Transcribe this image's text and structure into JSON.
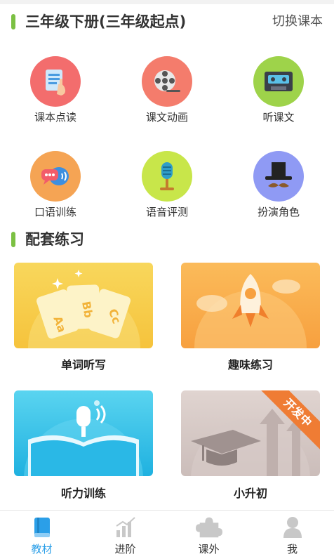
{
  "header": {
    "title": "三年级下册(三年级起点)",
    "switch_label": "切换课本",
    "accent": "#7bc043"
  },
  "features": [
    {
      "label": "课本点读",
      "icon": "book-reading-icon",
      "color": "#f36d6d"
    },
    {
      "label": "课文动画",
      "icon": "film-reel-icon",
      "color": "#f47c6c"
    },
    {
      "label": "听课文",
      "icon": "cassette-icon",
      "color": "#9ed34a"
    },
    {
      "label": "口语训练",
      "icon": "speech-bubbles-icon",
      "color": "#f5a454"
    },
    {
      "label": "语音评测",
      "icon": "microphone-icon",
      "color": "#c8e64a"
    },
    {
      "label": "扮演角色",
      "icon": "hat-mustache-icon",
      "color": "#8f9af4"
    }
  ],
  "practice": {
    "title": "配套练习",
    "cards": [
      {
        "label": "单词听写",
        "icon": "letter-cards-icon",
        "letters": [
          "Aa",
          "Bb",
          "Cc"
        ],
        "color": "#f9cf4a"
      },
      {
        "label": "趣味练习",
        "icon": "rocket-icon",
        "color": "#f8ab47"
      },
      {
        "label": "听力训练",
        "icon": "open-book-microphone-icon",
        "color": "#2fc0e6"
      },
      {
        "label": "小升初",
        "icon": "graduation-cap-icon",
        "color": "#cdbfbc",
        "badge": "开发中"
      }
    ]
  },
  "tabbar": {
    "active_color": "#2b9fe8",
    "tabs": [
      {
        "label": "教材",
        "icon": "book-icon",
        "active": true
      },
      {
        "label": "进阶",
        "icon": "bar-chart-icon",
        "active": false
      },
      {
        "label": "课外",
        "icon": "puzzle-icon",
        "active": false
      },
      {
        "label": "我",
        "icon": "person-icon",
        "active": false
      }
    ]
  }
}
